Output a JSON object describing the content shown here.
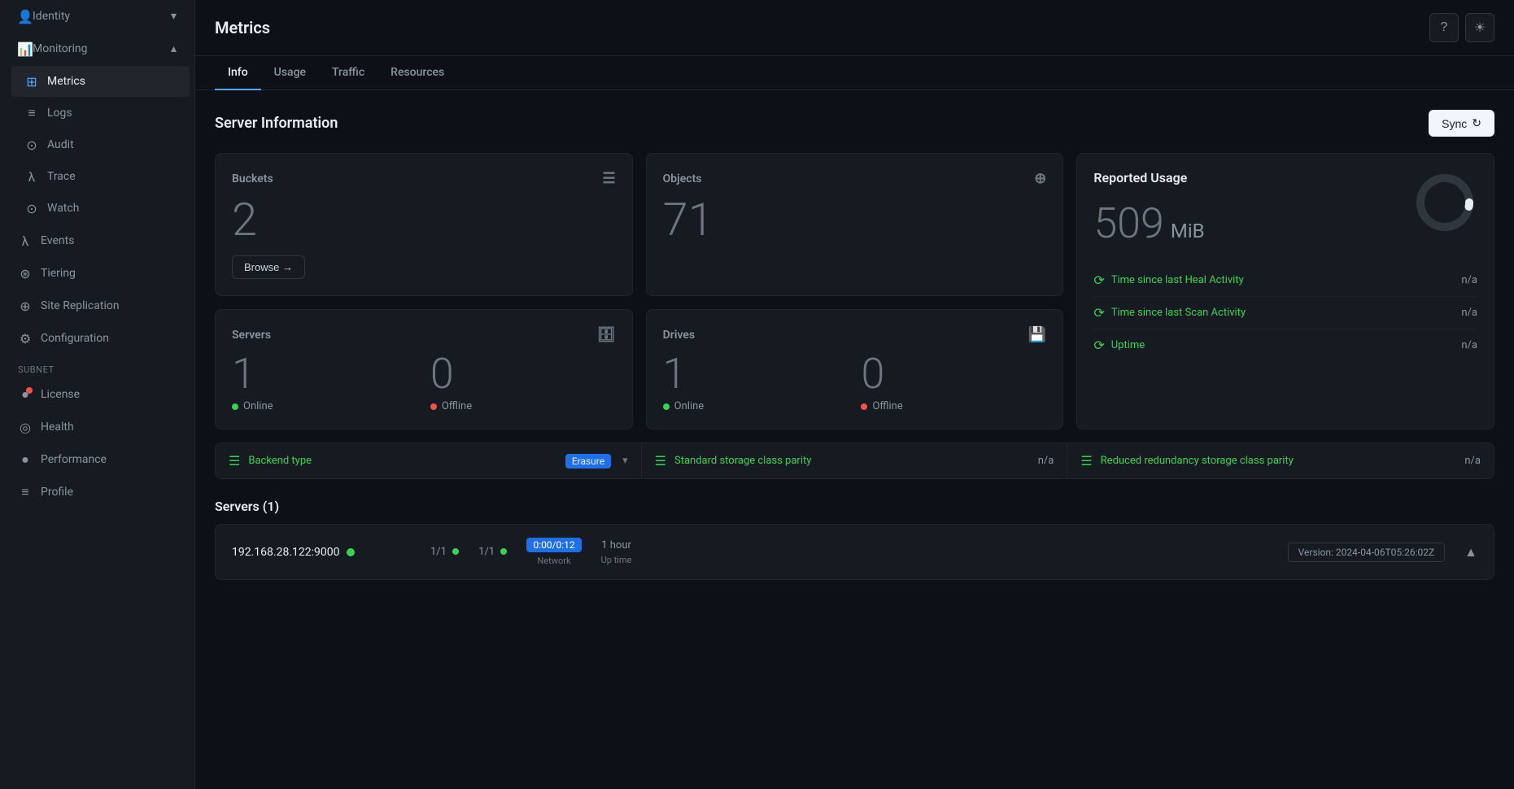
{
  "page": {
    "title": "Metrics"
  },
  "sidebar": {
    "identity_label": "Identity",
    "monitoring_label": "Monitoring",
    "items": [
      {
        "id": "metrics",
        "label": "Metrics",
        "icon": "⊞",
        "active": true
      },
      {
        "id": "logs",
        "label": "Logs",
        "icon": "≡"
      },
      {
        "id": "audit",
        "label": "Audit",
        "icon": "👤"
      },
      {
        "id": "trace",
        "label": "Trace",
        "icon": "λ"
      },
      {
        "id": "watch",
        "label": "Watch",
        "icon": "⊙"
      },
      {
        "id": "events",
        "label": "Events",
        "icon": "λ"
      },
      {
        "id": "tiering",
        "label": "Tiering",
        "icon": "⊛"
      },
      {
        "id": "site-replication",
        "label": "Site Replication",
        "icon": "⊕"
      },
      {
        "id": "configuration",
        "label": "Configuration",
        "icon": "⚙"
      }
    ],
    "subnet_label": "Subnet",
    "subnet_items": [
      {
        "id": "license",
        "label": "License",
        "icon": "●",
        "badge": true
      },
      {
        "id": "health",
        "label": "Health",
        "icon": "◎"
      },
      {
        "id": "performance",
        "label": "Performance",
        "icon": "●"
      },
      {
        "id": "profile",
        "label": "Profile",
        "icon": "≡"
      }
    ]
  },
  "tabs": [
    {
      "id": "info",
      "label": "Info",
      "active": true
    },
    {
      "id": "usage",
      "label": "Usage"
    },
    {
      "id": "traffic",
      "label": "Traffic"
    },
    {
      "id": "resources",
      "label": "Resources"
    }
  ],
  "server_information": {
    "title": "Server Information",
    "sync_label": "Sync",
    "buckets_card": {
      "title": "Buckets",
      "value": "2",
      "browse_label": "Browse →"
    },
    "objects_card": {
      "title": "Objects",
      "value": "71"
    },
    "reported_usage_card": {
      "title": "Reported Usage",
      "value": "509",
      "unit": "MiB",
      "rows": [
        {
          "label": "Time since last Heal Activity",
          "value": "n/a"
        },
        {
          "label": "Time since last Scan Activity",
          "value": "n/a"
        },
        {
          "label": "Uptime",
          "value": "n/a"
        }
      ]
    },
    "servers_card": {
      "title": "Servers",
      "online_value": "1",
      "online_label": "Online",
      "offline_value": "0",
      "offline_label": "Offline"
    },
    "drives_card": {
      "title": "Drives",
      "online_value": "1",
      "online_label": "Online",
      "offline_value": "0",
      "offline_label": "Offline"
    },
    "info_rows": [
      {
        "label": "Backend type",
        "value": "Erasure",
        "has_badge": true
      },
      {
        "label": "Standard storage class parity",
        "value": "n/a"
      },
      {
        "label": "Reduced redundancy storage class parity",
        "value": "n/a"
      }
    ]
  },
  "servers_section": {
    "title": "Servers (1)",
    "server": {
      "address": "192.168.28.122:9000",
      "drives_label": "1/1",
      "network_label": "1/1",
      "timer": "0:00/0:12",
      "network_stat": "Network",
      "uptime": "1 hour",
      "uptime_label": "Up time",
      "version": "Version: 2024-04-06T05:26:02Z"
    }
  }
}
